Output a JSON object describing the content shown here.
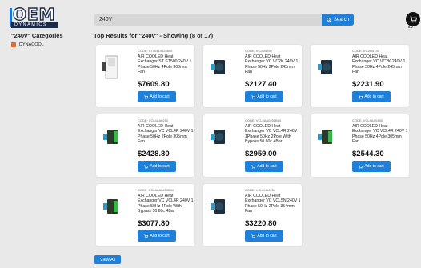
{
  "header": {
    "logo_text": "OEM",
    "logo_sub": "DYNAMICS",
    "search_value": "240V",
    "search_button": "Search",
    "cart_label": "0.0"
  },
  "sidebar": {
    "title": "\"240v\" Categories",
    "items": [
      {
        "label": "DYNACOOL",
        "checked": true
      }
    ]
  },
  "results": {
    "title": "Top Results for \"240v\" - Showing (8 of 17)",
    "view_all": "View All"
  },
  "products": [
    {
      "code": "CODE: ST50414424600",
      "name": "AIR COOLED Heat Exchanger ST ST500 240V 1 Phase 50Hz 4Pole 300mm Fan",
      "price": "$7609.80",
      "cta": "Add to cart",
      "thumb": "cabinet"
    },
    {
      "code": "CODE: VC2M4250",
      "name": "AIR COOLED Heat Exchanger VC VC2K 240V 1 Phase 50Hz 2Pole 245mm Fan",
      "price": "$2127.40",
      "cta": "Add to cart",
      "thumb": "fan-unit"
    },
    {
      "code": "CODE: VC2M4130",
      "name": "AIR COOLED Heat Exchanger VC VC2K 240V 1 Phase 50Hz 4Pole 245mm Fan",
      "price": "$2231.90",
      "cta": "Add to cart",
      "thumb": "fan-unit"
    },
    {
      "code": "CODE: VCL4AA0250",
      "name": "AIR COOLED Heat Exchanger VC VCL4R 240V 1 Phase 50Hz 2Pole 305mm Fan",
      "price": "$2428.80",
      "cta": "Add to cart",
      "thumb": "green-unit"
    },
    {
      "code": "CODE: VCL4AA0250B04",
      "name": "AIR COOLED Heat Exchanger VC VCL4R 240V 1Phase 50Hz 2Pole With Bypass 50 60c 4Bar",
      "price": "$2959.00",
      "cta": "Add to cart",
      "thumb": "fan-unit"
    },
    {
      "code": "CODE: VCL4AA0450",
      "name": "AIR COOLED Heat Exchanger VC VCL4R 240V 1 Phase 50Hz 4Pole 305mm Fan",
      "price": "$2544.30",
      "cta": "Add to cart",
      "thumb": "green-unit"
    },
    {
      "code": "CODE: VCL4AA0450B04",
      "name": "AIR COOLED Heat Exchanger VC VCL4R 240V 1 Phase 50Hz 4Pole With Bypass 50 60c 4Bar",
      "price": "$3077.80",
      "cta": "Add to cart",
      "thumb": "green-unit"
    },
    {
      "code": "CODE: VCL5NA0250",
      "name": "AIR COOLED Heat Exchanger VC VCL5N 240V 1 Phase 50Hz 2Pole 354mm Fan",
      "price": "$3220.80",
      "cta": "Add to cart",
      "thumb": "fan-unit"
    }
  ],
  "colors": {
    "accent": "#1e80d8",
    "checkbox": "#e8692a",
    "brand": "#1c2a4a"
  }
}
